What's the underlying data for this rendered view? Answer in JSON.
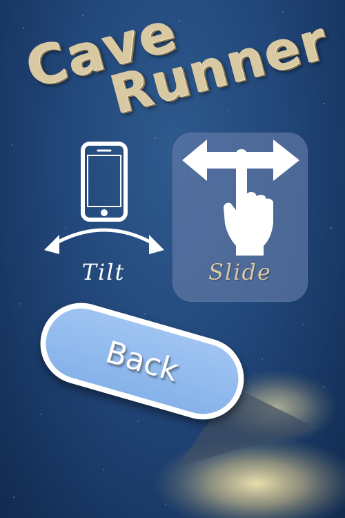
{
  "title": {
    "line1": "Cave",
    "line2": "Runner"
  },
  "controls": {
    "tilt": {
      "label": "Tilt",
      "icon": "phone-tilt-icon",
      "selected": false
    },
    "slide": {
      "label": "Slide",
      "icon": "finger-slide-icon",
      "selected": true
    }
  },
  "back_button": {
    "label": "Back"
  },
  "colors": {
    "background": "#22477a",
    "title": "#d9c9a3",
    "selected_panel": "#5f78a5",
    "button_fill": "#8fb8ee",
    "spotlight": "#f2e2a8"
  }
}
